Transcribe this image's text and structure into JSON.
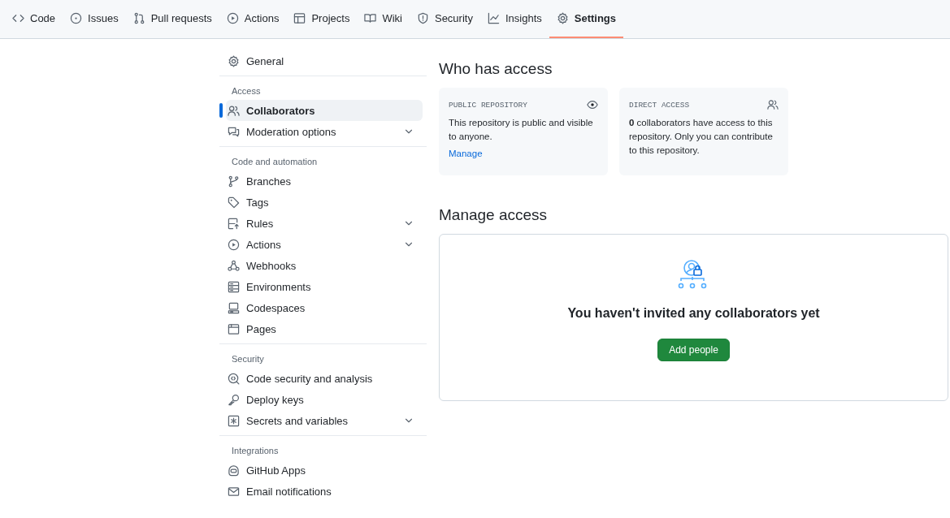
{
  "nav": {
    "tabs": [
      {
        "label": "Code",
        "selected": false
      },
      {
        "label": "Issues",
        "selected": false
      },
      {
        "label": "Pull requests",
        "selected": false
      },
      {
        "label": "Actions",
        "selected": false
      },
      {
        "label": "Projects",
        "selected": false
      },
      {
        "label": "Wiki",
        "selected": false
      },
      {
        "label": "Security",
        "selected": false
      },
      {
        "label": "Insights",
        "selected": false
      },
      {
        "label": "Settings",
        "selected": true
      }
    ]
  },
  "sidebar": {
    "sections": [
      {
        "items": [
          {
            "label": "General",
            "selected": false,
            "has_submenu": false
          }
        ]
      },
      {
        "heading": "Access",
        "items": [
          {
            "label": "Collaborators",
            "selected": true,
            "has_submenu": false
          },
          {
            "label": "Moderation options",
            "selected": false,
            "has_submenu": true
          }
        ]
      },
      {
        "heading": "Code and automation",
        "items": [
          {
            "label": "Branches",
            "selected": false,
            "has_submenu": false
          },
          {
            "label": "Tags",
            "selected": false,
            "has_submenu": false
          },
          {
            "label": "Rules",
            "selected": false,
            "has_submenu": true
          },
          {
            "label": "Actions",
            "selected": false,
            "has_submenu": true
          },
          {
            "label": "Webhooks",
            "selected": false,
            "has_submenu": false
          },
          {
            "label": "Environments",
            "selected": false,
            "has_submenu": false
          },
          {
            "label": "Codespaces",
            "selected": false,
            "has_submenu": false
          },
          {
            "label": "Pages",
            "selected": false,
            "has_submenu": false
          }
        ]
      },
      {
        "heading": "Security",
        "items": [
          {
            "label": "Code security and analysis",
            "selected": false,
            "has_submenu": false
          },
          {
            "label": "Deploy keys",
            "selected": false,
            "has_submenu": false
          },
          {
            "label": "Secrets and variables",
            "selected": false,
            "has_submenu": true
          }
        ]
      },
      {
        "heading": "Integrations",
        "items": [
          {
            "label": "GitHub Apps",
            "selected": false,
            "has_submenu": false
          },
          {
            "label": "Email notifications",
            "selected": false,
            "has_submenu": false
          }
        ]
      }
    ]
  },
  "who_has_access": {
    "title": "Who has access",
    "cards": [
      {
        "label": "PUBLIC REPOSITORY",
        "text": "This repository is public and visible to anyone.",
        "link": "Manage"
      },
      {
        "label": "DIRECT ACCESS",
        "text": "**0** collaborators have access to this repository. Only you can contribute to this repository."
      }
    ]
  },
  "manage_access": {
    "title": "Manage access",
    "empty_message": "You haven't invited any collaborators yet",
    "button": "Add people"
  }
}
